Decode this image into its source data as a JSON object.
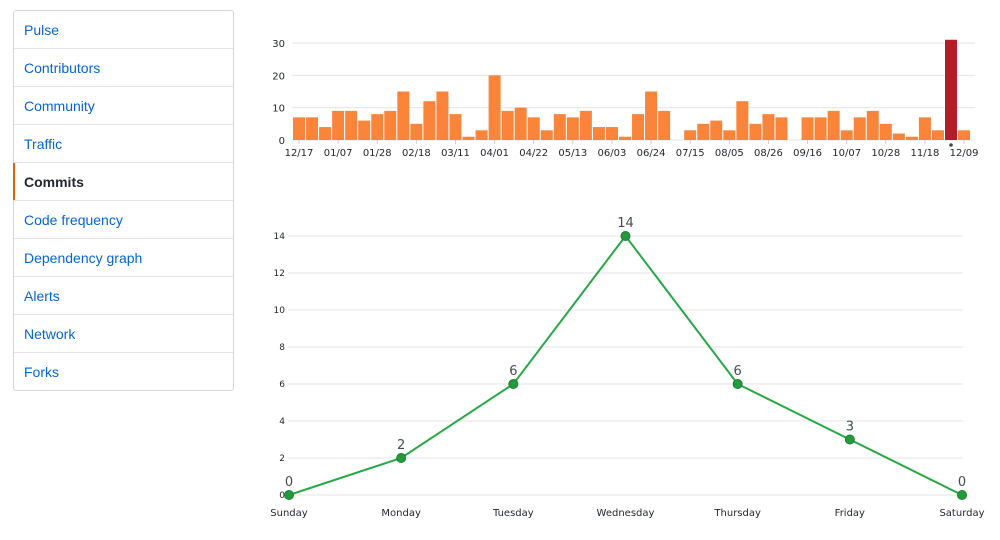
{
  "sidebar": {
    "items": [
      {
        "label": "Pulse",
        "selected": false
      },
      {
        "label": "Contributors",
        "selected": false
      },
      {
        "label": "Community",
        "selected": false
      },
      {
        "label": "Traffic",
        "selected": false
      },
      {
        "label": "Commits",
        "selected": true
      },
      {
        "label": "Code frequency",
        "selected": false
      },
      {
        "label": "Dependency graph",
        "selected": false
      },
      {
        "label": "Alerts",
        "selected": false
      },
      {
        "label": "Network",
        "selected": false
      },
      {
        "label": "Forks",
        "selected": false
      }
    ]
  },
  "colors": {
    "bar": "#f9843a",
    "bar_selected": "#b31d28",
    "line": "#28a745",
    "point": "#239a3b",
    "grid": "#e5e5e5",
    "link": "#0366d6",
    "active_border": "#e36209"
  },
  "chart_data": [
    {
      "type": "bar",
      "title": "",
      "xlabel": "",
      "ylabel": "",
      "ylim": [
        0,
        30
      ],
      "yticks": [
        0,
        10,
        20,
        30
      ],
      "grid": true,
      "tick_labels": [
        "12/17",
        "01/07",
        "01/28",
        "02/18",
        "03/11",
        "04/01",
        "04/22",
        "05/13",
        "06/03",
        "06/24",
        "07/15",
        "08/05",
        "08/26",
        "09/16",
        "10/07",
        "10/28",
        "11/18",
        "12/09"
      ],
      "tick_every": 3,
      "selected_index": 50,
      "values": [
        7,
        7,
        4,
        9,
        9,
        6,
        8,
        9,
        15,
        5,
        12,
        15,
        8,
        1,
        3,
        20,
        9,
        10,
        7,
        3,
        8,
        7,
        9,
        4,
        4,
        1,
        8,
        15,
        9,
        0,
        3,
        5,
        6,
        3,
        12,
        5,
        8,
        7,
        0,
        7,
        7,
        9,
        3,
        7,
        9,
        5,
        2,
        1,
        7,
        3,
        31,
        3
      ]
    },
    {
      "type": "line",
      "title": "",
      "xlabel": "",
      "ylabel": "",
      "categories": [
        "Sunday",
        "Monday",
        "Tuesday",
        "Wednesday",
        "Thursday",
        "Friday",
        "Saturday"
      ],
      "values": [
        0,
        2,
        6,
        14,
        6,
        3,
        0
      ],
      "ylim": [
        0,
        14
      ],
      "yticks": [
        0,
        2,
        4,
        6,
        8,
        10,
        12,
        14
      ],
      "grid": true,
      "data_labels": true
    }
  ]
}
